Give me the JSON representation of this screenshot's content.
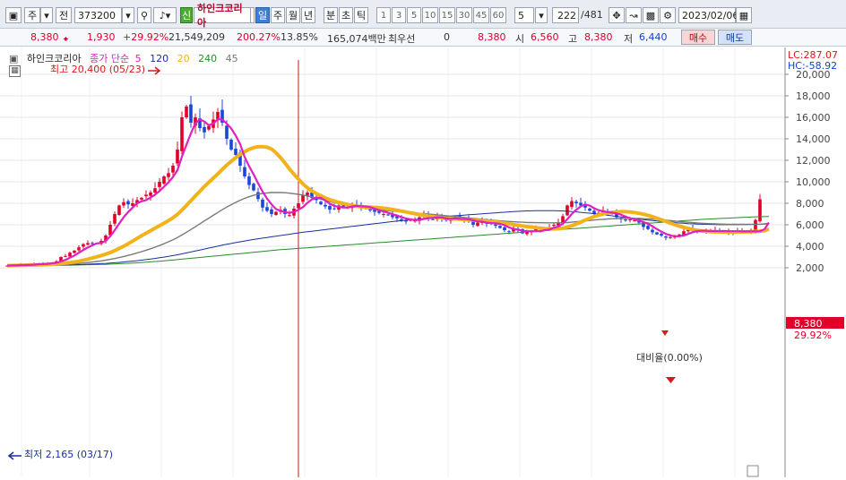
{
  "toolbar": {
    "type_label": "주",
    "mode_label": "전",
    "code": "373200",
    "new_badge": "신",
    "stock_name": "하인크코리아",
    "periods": [
      "일",
      "주",
      "월",
      "년",
      "분",
      "초",
      "틱"
    ],
    "active_period": "일",
    "intervals": [
      "1",
      "3",
      "5",
      "10",
      "15",
      "30",
      "45",
      "60"
    ],
    "interval_value": "5",
    "count": "222",
    "total": "/481",
    "date": "2023/02/06"
  },
  "quote": {
    "price": "8,380",
    "change": "1,930",
    "change_pct": "+29.92%",
    "volume": "21,549,209",
    "volume_ratio": "200.27%",
    "turnover": "13.85%",
    "amount": "165,074백만",
    "best_bid_label": "최우선",
    "best_bid_value": "0",
    "best_ask": "8,380",
    "open_label": "시",
    "open_value": "6,560",
    "high_label": "고",
    "high_value": "8,380",
    "low_label": "저",
    "low_value": "6,440",
    "buy_label": "매수",
    "sell_label": "매도"
  },
  "legend": {
    "name": "하인크코리아",
    "ma_label": "종가 단순",
    "ma5": "5",
    "ma120": "120",
    "ma20": "20",
    "ma240": "240",
    "ma45": "45"
  },
  "annotations": {
    "high_label": "최고 20,400 (05/23)",
    "low_label": "최저 2,165 (03/17)",
    "ratio_label": "대비율(0.00%)",
    "lc": "LC:287.07",
    "hc": "HC:-58.92",
    "price_tag": "8,380",
    "pct_tag": "29.92%"
  },
  "colors": {
    "up": "#e0002a",
    "down": "#1b46d8",
    "ma5": "#e020c0",
    "ma20": "#f2b21a",
    "ma45": "#7a7a7a",
    "ma120": "#1a2fa0",
    "ma240": "#2a8a2a",
    "marker": "#d41a1a"
  },
  "chart_data": {
    "type": "candlestick",
    "y_ticks": [
      "20,000",
      "18,000",
      "16,000",
      "14,000",
      "12,000",
      "10,000",
      "8,000",
      "6,000",
      "4,000",
      "2,000"
    ],
    "ylim": [
      1300,
      20400
    ],
    "close": [
      2200,
      2250,
      2200,
      2300,
      2250,
      2350,
      2300,
      2400,
      2350,
      2450,
      2500,
      2600,
      3000,
      3100,
      3400,
      3600,
      3900,
      4200,
      4300,
      4250,
      4300,
      4500,
      5000,
      6000,
      7000,
      7800,
      8100,
      7900,
      8000,
      8300,
      8500,
      8800,
      9000,
      9400,
      10000,
      10500,
      10800,
      11500,
      13000,
      16000,
      17000,
      15500,
      16000,
      15000,
      14600,
      15200,
      15800,
      16500,
      15500,
      14000,
      13000,
      12500,
      11500,
      10500,
      9700,
      9200,
      8400,
      7600,
      7300,
      7000,
      7200,
      7400,
      7000,
      6900,
      7500,
      8000,
      8800,
      9000,
      8500,
      8300,
      7900,
      7700,
      7400,
      7500,
      7800,
      7600,
      7700,
      7900,
      7800,
      7600,
      7500,
      7400,
      7200,
      7100,
      7000,
      6900,
      6700,
      6600,
      6400,
      6300,
      6500,
      6400,
      6700,
      6900,
      6600,
      6500,
      6800,
      6600,
      6400,
      6500,
      6700,
      6600,
      6500,
      6300,
      6000,
      6200,
      6400,
      6100,
      6100,
      5900,
      5700,
      5500,
      5400,
      5600,
      5500,
      5200,
      5300,
      5400,
      5600,
      5500,
      5700,
      5800,
      6000,
      6200,
      6800,
      7800,
      8200,
      8000,
      7800,
      7600,
      7300,
      7000,
      7100,
      7300,
      7200,
      7000,
      6700,
      6500,
      6400,
      6500,
      6400,
      6200,
      5800,
      5600,
      5300,
      5100,
      5000,
      4800,
      4850,
      4900,
      5100,
      5400,
      5600,
      5500,
      5400,
      5300,
      5400,
      5500,
      5500,
      5400,
      5300,
      5400,
      5300,
      5400,
      5500,
      5300,
      5400,
      6440,
      8380
    ],
    "ma5": [
      2200,
      2220,
      2220,
      2240,
      2250,
      2270,
      2280,
      2330,
      2340,
      2370,
      2420,
      2460,
      2590,
      2730,
      2930,
      3140,
      3400,
      3660,
      3880,
      4080,
      4270,
      4310,
      4520,
      4930,
      5490,
      6120,
      6700,
      7190,
      7600,
      8000,
      8180,
      8300,
      8530,
      8800,
      9140,
      9540,
      9940,
      10440,
      11080,
      12340,
      13440,
      14500,
      15440,
      15800,
      15620,
      15260,
      15430,
      15820,
      15800,
      15420,
      14960,
      14300,
      13500,
      12300,
      11440,
      10680,
      9860,
      9080,
      8440,
      7900,
      7460,
      7300,
      7180,
      7100,
      7200,
      7400,
      7640,
      8040,
      8360,
      8520,
      8500,
      8260,
      7960,
      7760,
      7660,
      7620,
      7600,
      7700,
      7760,
      7720,
      7700,
      7640,
      7500,
      7360,
      7240,
      7120,
      6980,
      6860,
      6720,
      6580,
      6500,
      6440,
      6460,
      6540,
      6620,
      6640,
      6700,
      6680,
      6580,
      6560,
      6600,
      6560,
      6540,
      6520,
      6420,
      6320,
      6300,
      6200,
      6160,
      6140,
      6080,
      5960,
      5760,
      5620,
      5540,
      5440,
      5400,
      5400,
      5400,
      5400,
      5500,
      5560,
      5720,
      5840,
      6100,
      6520,
      7000,
      7400,
      7720,
      7880,
      7780,
      7540,
      7360,
      7260,
      7180,
      7120,
      7060,
      6940,
      6760,
      6620,
      6500,
      6400,
      6260,
      6100,
      5860,
      5600,
      5360,
      5160,
      5010,
      4930,
      4930,
      5010,
      5150,
      5310,
      5410,
      5440,
      5440,
      5420,
      5420,
      5420,
      5420,
      5400,
      5400,
      5400,
      5380,
      5380,
      5380,
      5380,
      5400,
      5580,
      6210
    ],
    "ma20": [
      2200,
      2210,
      2220,
      2230,
      2240,
      2250,
      2260,
      2270,
      2280,
      2300,
      2320,
      2350,
      2390,
      2430,
      2480,
      2540,
      2610,
      2700,
      2800,
      2910,
      3020,
      3140,
      3270,
      3420,
      3600,
      3800,
      4000,
      4230,
      4480,
      4730,
      4980,
      5220,
      5450,
      5680,
      5920,
      6150,
      6390,
      6650,
      6970,
      7370,
      7800,
      8240,
      8690,
      9120,
      9560,
      9960,
      10340,
      10730,
      11150,
      11550,
      11900,
      12240,
      12550,
      12800,
      13020,
      13180,
      13260,
      13270,
      13220,
      13050,
      12700,
      12250,
      11750,
      11200,
      10700,
      10250,
      9800,
      9450,
      9150,
      8900,
      8700,
      8500,
      8330,
      8200,
      8080,
      7980,
      7880,
      7790,
      7720,
      7680,
      7660,
      7640,
      7620,
      7590,
      7550,
      7490,
      7420,
      7350,
      7270,
      7190,
      7110,
      7030,
      6960,
      6880,
      6810,
      6750,
      6700,
      6650,
      6610,
      6570,
      6540,
      6510,
      6490,
      6460,
      6430,
      6400,
      6370,
      6340,
      6300,
      6260,
      6210,
      6150,
      6090,
      6020,
      5960,
      5890,
      5830,
      5780,
      5730,
      5680,
      5650,
      5630,
      5620,
      5630,
      5680,
      5780,
      5910,
      6070,
      6250,
      6430,
      6600,
      6760,
      6900,
      7010,
      7100,
      7160,
      7200,
      7220,
      7220,
      7190,
      7140,
      7070,
      6980,
      6880,
      6760,
      6620,
      6470,
      6310,
      6160,
      6010,
      5880,
      5760,
      5660,
      5560,
      5490,
      5430,
      5390,
      5360,
      5340,
      5330,
      5320,
      5320,
      5320,
      5320,
      5330,
      5340,
      5360,
      5380,
      5400,
      5450,
      5600
    ],
    "ma45": [
      2200,
      2200,
      2210,
      2210,
      2220,
      2220,
      2230,
      2230,
      2240,
      2250,
      2260,
      2270,
      2290,
      2310,
      2330,
      2360,
      2400,
      2440,
      2480,
      2530,
      2580,
      2640,
      2710,
      2780,
      2860,
      2950,
      3050,
      3150,
      3260,
      3380,
      3500,
      3630,
      3770,
      3920,
      4070,
      4240,
      4420,
      4610,
      4820,
      5050,
      5300,
      5560,
      5820,
      6090,
      6360,
      6620,
      6880,
      7140,
      7400,
      7640,
      7870,
      8080,
      8280,
      8460,
      8610,
      8740,
      8840,
      8920,
      8970,
      9000,
      9010,
      9000,
      8980,
      8940,
      8890,
      8830,
      8760,
      8680,
      8590,
      8490,
      8380,
      8270,
      8160,
      8060,
      7960,
      7870,
      7790,
      7720,
      7650,
      7590,
      7530,
      7480,
      7430,
      7390,
      7350,
      7310,
      7270,
      7240,
      7200,
      7170,
      7130,
      7100,
      7060,
      7030,
      6990,
      6960,
      6920,
      6880,
      6840,
      6800,
      6760,
      6720,
      6680,
      6640,
      6600,
      6560,
      6520,
      6480,
      6440,
      6400,
      6370,
      6340,
      6310,
      6280,
      6260,
      6240,
      6220,
      6210,
      6200,
      6190,
      6180,
      6180,
      6180,
      6180,
      6190,
      6210,
      6240,
      6280,
      6320,
      6360,
      6400,
      6440,
      6480,
      6510,
      6540,
      6560,
      6580,
      6590,
      6600,
      6600,
      6600,
      6590,
      6570,
      6550,
      6530,
      6500,
      6470,
      6430,
      6390,
      6350,
      6310,
      6270,
      6230,
      6200,
      6170,
      6140,
      6120,
      6100,
      6080,
      6070,
      6060,
      6050,
      6040,
      6040,
      6040,
      6040,
      6040,
      6040,
      6050,
      6080,
      6140
    ],
    "ma120": [
      2200,
      2200,
      2200,
      2210,
      2210,
      2210,
      2220,
      2220,
      2220,
      2230,
      2230,
      2240,
      2250,
      2260,
      2270,
      2280,
      2300,
      2310,
      2330,
      2350,
      2370,
      2390,
      2410,
      2440,
      2470,
      2500,
      2540,
      2580,
      2620,
      2660,
      2710,
      2760,
      2810,
      2870,
      2930,
      2990,
      3060,
      3130,
      3210,
      3290,
      3380,
      3470,
      3560,
      3650,
      3740,
      3830,
      3920,
      4010,
      4100,
      4180,
      4260,
      4340,
      4420,
      4490,
      4560,
      4630,
      4700,
      4760,
      4820,
      4880,
      4940,
      5000,
      5060,
      5120,
      5180,
      5240,
      5300,
      5350,
      5400,
      5450,
      5500,
      5550,
      5600,
      5650,
      5700,
      5750,
      5800,
      5850,
      5900,
      5950,
      6000,
      6050,
      6100,
      6150,
      6200,
      6250,
      6300,
      6340,
      6380,
      6420,
      6460,
      6500,
      6540,
      6580,
      6620,
      6660,
      6700,
      6740,
      6780,
      6810,
      6840,
      6870,
      6900,
      6930,
      6960,
      6990,
      7020,
      7050,
      7080,
      7110,
      7140,
      7170,
      7200,
      7230,
      7250,
      7270,
      7290,
      7300,
      7310,
      7320,
      7320,
      7320,
      7310,
      7300,
      7280,
      7260,
      7230,
      7200,
      7160,
      7120,
      7080,
      7030,
      6980,
      6930,
      6880,
      6830,
      6780,
      6730,
      6680,
      6630,
      6580,
      6530,
      6480,
      6430,
      6390,
      6350,
      6310,
      6270,
      6230,
      6200,
      6170,
      6140,
      6110,
      6090,
      6070,
      6050,
      6040,
      6030,
      6020,
      6010,
      6010,
      6010,
      6010,
      6010,
      6020,
      6020,
      6030,
      6040,
      6050,
      6060,
      6080
    ],
    "ma240": [
      2200,
      2200,
      2200,
      2200,
      2210,
      2210,
      2210,
      2210,
      2220,
      2220,
      2220,
      2230,
      2230,
      2240,
      2240,
      2250,
      2260,
      2270,
      2280,
      2290,
      2300,
      2310,
      2320,
      2340,
      2360,
      2380,
      2400,
      2420,
      2440,
      2460,
      2490,
      2520,
      2550,
      2580,
      2610,
      2640,
      2680,
      2720,
      2760,
      2800,
      2840,
      2880,
      2920,
      2960,
      3000,
      3040,
      3080,
      3120,
      3160,
      3200,
      3240,
      3280,
      3320,
      3360,
      3400,
      3440,
      3480,
      3520,
      3560,
      3600,
      3640,
      3680,
      3710,
      3740,
      3770,
      3800,
      3830,
      3860,
      3890,
      3920,
      3950,
      3980,
      4010,
      4040,
      4070,
      4100,
      4130,
      4160,
      4190,
      4220,
      4250,
      4280,
      4310,
      4340,
      4370,
      4400,
      4430,
      4460,
      4490,
      4520,
      4550,
      4580,
      4610,
      4640,
      4670,
      4700,
      4730,
      4760,
      4790,
      4820,
      4850,
      4880,
      4910,
      4940,
      4970,
      5000,
      5030,
      5060,
      5090,
      5120,
      5150,
      5180,
      5210,
      5240,
      5270,
      5300,
      5330,
      5360,
      5390,
      5420,
      5450,
      5480,
      5510,
      5540,
      5570,
      5600,
      5630,
      5660,
      5690,
      5720,
      5750,
      5780,
      5810,
      5840,
      5870,
      5900,
      5930,
      5960,
      5990,
      6020,
      6050,
      6080,
      6110,
      6140,
      6170,
      6200,
      6230,
      6260,
      6290,
      6320,
      6350,
      6380,
      6410,
      6440,
      6470,
      6500,
      6520,
      6540,
      6560,
      6580,
      6600,
      6620,
      6640,
      6660,
      6680,
      6700,
      6720,
      6740,
      6750,
      6760,
      6770
    ]
  }
}
